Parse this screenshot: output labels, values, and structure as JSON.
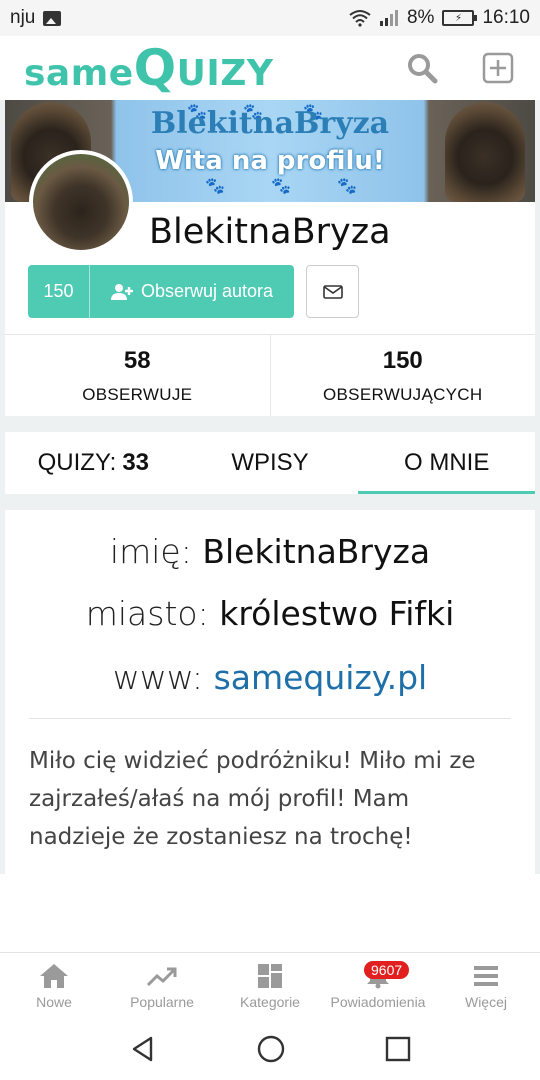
{
  "status_bar": {
    "carrier": "nju",
    "battery": "8%",
    "time": "16:10"
  },
  "app": {
    "logo_same": "same",
    "logo_q": "Q",
    "logo_uizy": "UIZY"
  },
  "banner": {
    "title": "BlekitnaBryza",
    "subtitle": "Wita na profilu!"
  },
  "profile": {
    "username": "BlekitnaBryza",
    "follow_count": "150",
    "follow_label": "Obserwuj autora",
    "stats": [
      {
        "value": "58",
        "label": "OBSERWUJE"
      },
      {
        "value": "150",
        "label": "OBSERWUJĄCYCH"
      }
    ]
  },
  "tabs": {
    "quizy_label": "QUIZY:",
    "quizy_count": "33",
    "wpisy": "WPISY",
    "o_mnie": "O MNIE"
  },
  "about": {
    "name_label": "imię:",
    "name_value": "BlekitnaBryza",
    "city_label": "miasto:",
    "city_value": "królestwo Fifki",
    "www_label": "www:",
    "www_value": "samequizy.pl",
    "bio": "Miło cię widzieć podróżniku! Miło mi ze zajrzałeś/ałaś na mój profil! Mam nadzieje że zostaniesz na trochę!"
  },
  "bottom_nav": {
    "items": [
      {
        "label": "Nowe"
      },
      {
        "label": "Popularne"
      },
      {
        "label": "Kategorie"
      },
      {
        "label": "Powiadomienia",
        "badge": "9607"
      },
      {
        "label": "Więcej"
      }
    ]
  },
  "colors": {
    "accent": "#4fcab3",
    "link": "#1f6fa8",
    "badge": "#e11f1f"
  }
}
